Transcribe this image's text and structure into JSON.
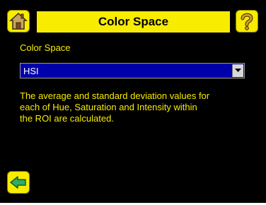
{
  "header": {
    "title": "Color Space",
    "home_icon": "home-icon",
    "help_icon": "question-mark-icon"
  },
  "field": {
    "label": "Color Space",
    "selected_value": "HSI",
    "dropdown_icon": "chevron-down-icon"
  },
  "description": {
    "line1": "The average and standard deviation values for",
    "line2": "each of Hue, Saturation and Intensity within",
    "line3": "the ROI are calculated."
  },
  "footer": {
    "back_icon": "back-arrow-icon"
  },
  "colors": {
    "background": "#000000",
    "accent_yellow": "#f8ec00",
    "dropdown_blue": "#0000aa",
    "text_white": "#ffffff"
  }
}
